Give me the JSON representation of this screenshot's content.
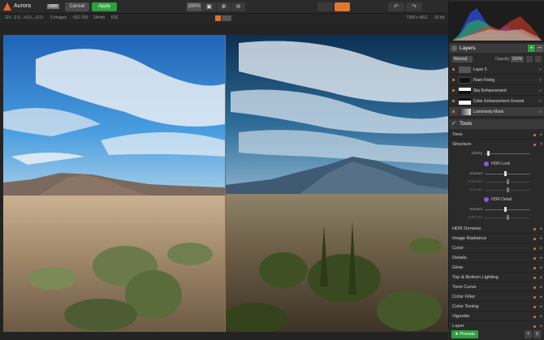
{
  "app": {
    "name_prefix": "Aurora",
    "name_badge": "HDR"
  },
  "toolbar": {
    "cancel_label": "Cancel",
    "apply_label": "Apply",
    "zoom_value": "100%",
    "zoom_fit_icon": "fit-icon",
    "zoom_in_icon": "zoom-in-icon",
    "zoom_out_icon": "zoom-out-icon",
    "undo_icon": "↶",
    "redo_icon": "↷",
    "hand_icon": "✋",
    "brush_icon": "╱",
    "layers_icon": "▤",
    "screen_icon": "▭"
  },
  "info": {
    "ev": "EV",
    "ev_values": "-2.0...+0.0...+2.0",
    "images": "5 images",
    "iso": "ISO 100",
    "focal": "24mm",
    "aperture": "f/16",
    "resolution": "7358 x 4911",
    "bits": "33 bit"
  },
  "layers": {
    "title": "Layers",
    "blend_mode": "Normal",
    "opacity_label": "Opacity:",
    "opacity_value": "100%",
    "items": [
      {
        "name": "Layer 5"
      },
      {
        "name": "Flare Fixing"
      },
      {
        "name": "Sky Enhancement"
      },
      {
        "name": "Color Enhancement Ground"
      },
      {
        "name": "Luminosity Mask"
      }
    ]
  },
  "tools": {
    "title": "Tools",
    "tone": "Tone",
    "structure": "Structure",
    "clarity_label": "Clarity",
    "hdr_look": "HDR Look",
    "amount_label": "Amount",
    "softness_label": "Softness",
    "smooth_label": "Smooth",
    "hdr_detail": "HDR Detail",
    "amount2_label": "Amount",
    "softness2_label": "Softness",
    "list": [
      "HDR Denoise",
      "Image Radiance",
      "Color",
      "Details",
      "Glow",
      "Top & Bottom Lighting",
      "Tone Curve",
      "Color Filter",
      "Color Toning",
      "Vignette",
      "Layer"
    ]
  },
  "bottom": {
    "presets_label": "Presets"
  },
  "sliders": {
    "clarity": 0.05,
    "amount": 0.45,
    "softness": 0.5,
    "smooth": 0.5,
    "amount2": 0.45,
    "softness2": 0.5
  },
  "colors": {
    "accent": "#e27730",
    "apply_green": "#2e9f3e",
    "divider": "#d9531e"
  }
}
